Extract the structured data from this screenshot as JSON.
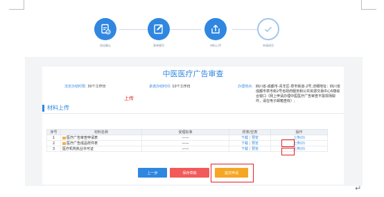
{
  "steps": [
    {
      "label": "协议确认",
      "status": "done",
      "icon": "contract-check-icon"
    },
    {
      "label": "表单填写",
      "status": "done",
      "icon": "form-edit-icon"
    },
    {
      "label": "材料上传",
      "status": "current",
      "icon": "upload-icon"
    },
    {
      "label": "申请成功",
      "status": "pending",
      "icon": "check-circle-icon"
    }
  ],
  "title": "中医医疗广告审查",
  "info": {
    "legal_time_label": "法定办结时限:",
    "legal_time_value": "30个工作日",
    "promised_time_label": "承诺办结时间:",
    "promised_time_value": "10个工作日",
    "location_label": "办理地点:",
    "location_value": "四川省-成都市-青羊区-草市街道-2号,详细地址：四川省成都市草市街2号省政府服务和公共资源交易中心6楼综合窗口（网上申请办理中医医疗广告审查不需现场取件，请在电子邮箱查收）;"
  },
  "annotation_upload": "上传",
  "section_title": "材料上传",
  "table": {
    "headers": [
      "序号",
      "材料名称",
      "受理标准",
      "样表/空表",
      "操作"
    ],
    "rows": [
      {
        "no": "1",
        "name": "医疗广告审查申请表",
        "standard": "——",
        "download": "下载",
        "preview": "预览",
        "action": "上传(0)",
        "has_icon": true
      },
      {
        "no": "2",
        "name": "医疗广告成品样件表",
        "standard": "——",
        "download": "下载",
        "preview": "预览",
        "action": "上传(0)",
        "has_icon": true
      },
      {
        "no": "3",
        "name": "医疗机构执业许可证",
        "standard": "——",
        "download": "下载",
        "preview": "预览",
        "action": "上传(0)",
        "has_icon": false
      }
    ],
    "sep": "|"
  },
  "buttons": {
    "prev": "上一步",
    "save": "保存草稿",
    "submit": "提交申请"
  },
  "return_mark": "↵",
  "colors": {
    "primary": "#2f87e0",
    "danger": "#f2595b",
    "warning": "#f5a623",
    "annotation": "#e02020"
  }
}
